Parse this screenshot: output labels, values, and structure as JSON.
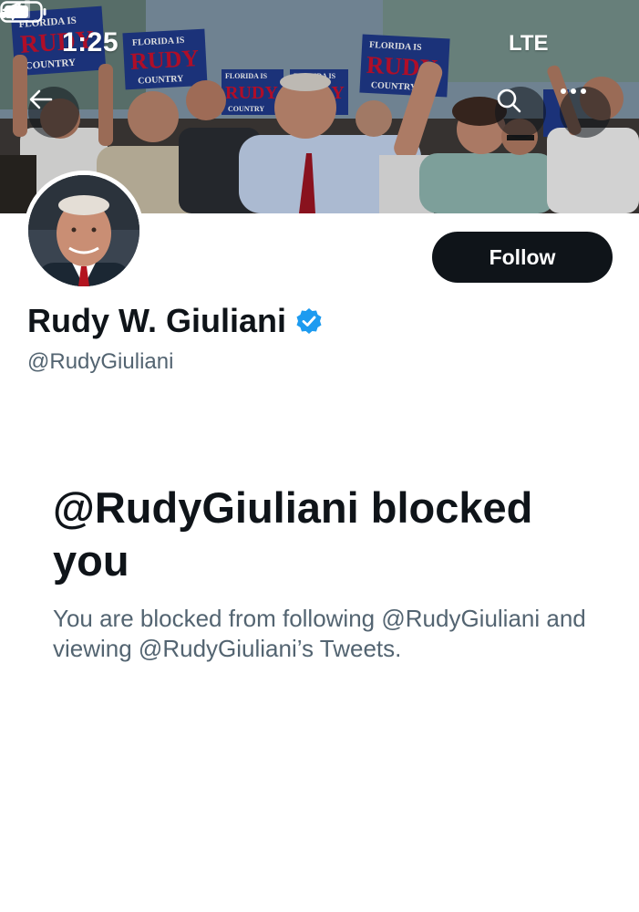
{
  "status_bar": {
    "time": "1:25",
    "network": "LTE"
  },
  "header": {
    "sign_texts": [
      "FLORIDA IS",
      "RUDY",
      "COUNTRY"
    ]
  },
  "profile": {
    "display_name": "Rudy W. Giuliani",
    "handle": "@RudyGiuliani",
    "verified": true,
    "follow_label": "Follow"
  },
  "blocked_notice": {
    "title": "@RudyGiuliani blocked you",
    "description": "You are blocked from following @RudyGiuliani and viewing @RudyGiuliani’s Tweets."
  },
  "colors": {
    "text_primary": "#0f1419",
    "text_secondary": "#536471",
    "verified": "#1d9bf0",
    "follow_button_bg": "#0f1419",
    "sign_blue": "#1f3a8a",
    "sign_red": "#c8102e"
  },
  "icons": {
    "back": "arrow-left-icon",
    "search": "search-icon",
    "more": "more-horizontal-icon",
    "location": "location-arrow-icon",
    "signal": "cellular-signal-icon",
    "battery": "battery-icon",
    "verified": "verified-badge-icon"
  }
}
